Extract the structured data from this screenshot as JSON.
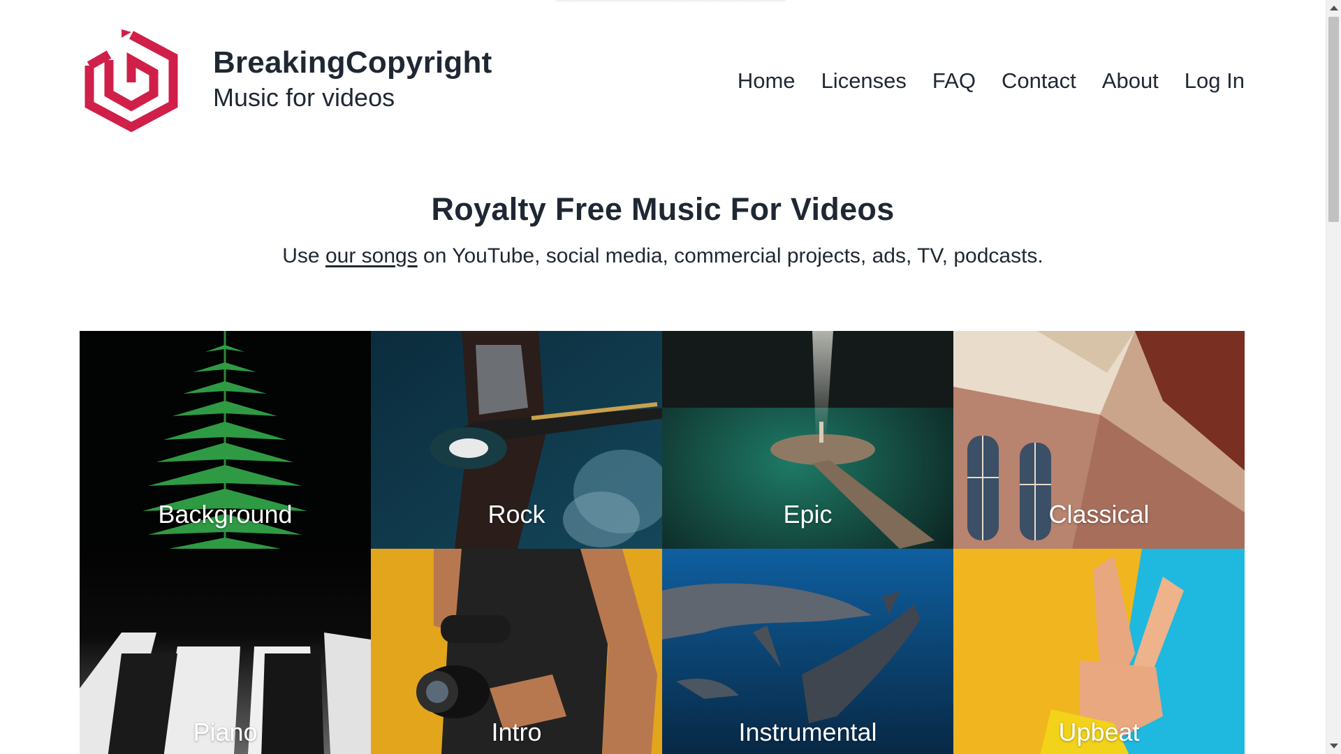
{
  "brand": {
    "name": "BreakingCopyright",
    "tagline": "Music for videos",
    "logo_color": "#d01f49"
  },
  "nav": {
    "items": [
      "Home",
      "Licenses",
      "FAQ",
      "Contact",
      "About",
      "Log In"
    ]
  },
  "hero": {
    "title": "Royalty Free Music For Videos",
    "sub_before": "Use ",
    "sub_link": "our songs",
    "sub_after": " on YouTube, social media, commercial projects, ads, TV, podcasts."
  },
  "genres": [
    {
      "label": "Background",
      "icon": "fern-image"
    },
    {
      "label": "Rock",
      "icon": "guitarist-image"
    },
    {
      "label": "Epic",
      "icon": "island-light-image"
    },
    {
      "label": "Classical",
      "icon": "ornate-ceiling-image"
    },
    {
      "label": "Piano",
      "icon": "piano-keys-image"
    },
    {
      "label": "Intro",
      "icon": "camera-person-image"
    },
    {
      "label": "Instrumental",
      "icon": "dolphins-image"
    },
    {
      "label": "Upbeat",
      "icon": "peace-hand-image"
    }
  ],
  "colors": {
    "text": "#1f2733",
    "accent": "#d01f49"
  }
}
